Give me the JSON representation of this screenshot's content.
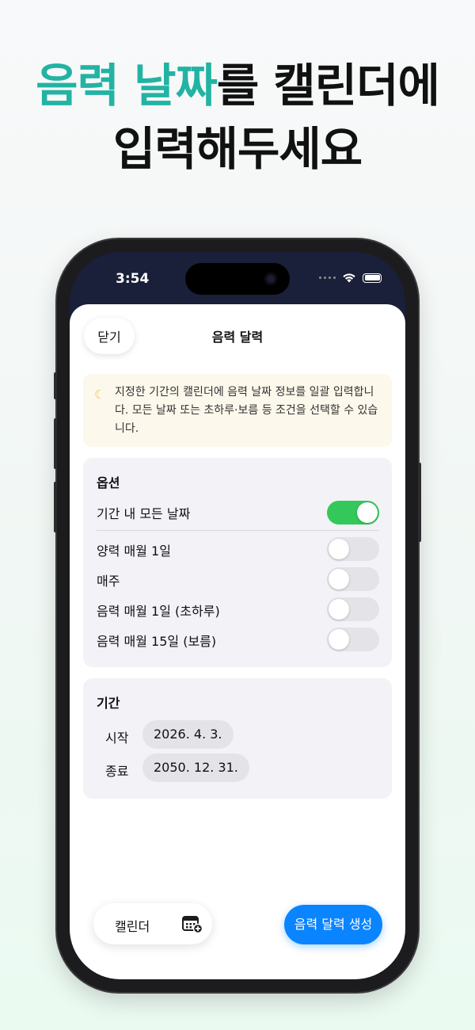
{
  "headline": {
    "accent": "음력 날짜",
    "rest_line1": "를 캘린더에",
    "line2": "입력해두세요"
  },
  "status_bar": {
    "time": "3:54"
  },
  "sheet": {
    "close_label": "닫기",
    "title": "음력 달력"
  },
  "notice": {
    "icon": "moon-icon",
    "text": "지정한 기간의 캘린더에 음력 날짜 정보를 일괄 입력합니다. 모든 날짜 또는 초하루·보름 등 조건을 선택할 수 있습니다."
  },
  "options": {
    "title": "옵션",
    "items": [
      {
        "label": "기간 내 모든 날짜",
        "on": true
      },
      {
        "label": "양력 매월 1일",
        "on": false
      },
      {
        "label": "매주",
        "on": false
      },
      {
        "label": "음력 매월 1일 (초하루)",
        "on": false
      },
      {
        "label": "음력 매월 15일 (보름)",
        "on": false
      }
    ]
  },
  "period": {
    "title": "기간",
    "start_label": "시작",
    "start_value": "2026. 4. 3.",
    "end_label": "종료",
    "end_value": "2050. 12. 31."
  },
  "bottom": {
    "calendar_label": "캘린더",
    "create_label": "음력 달력 생성"
  },
  "colors": {
    "accent_teal": "#22b3a3",
    "toggle_on": "#34c759",
    "primary_blue": "#0a84ff"
  }
}
